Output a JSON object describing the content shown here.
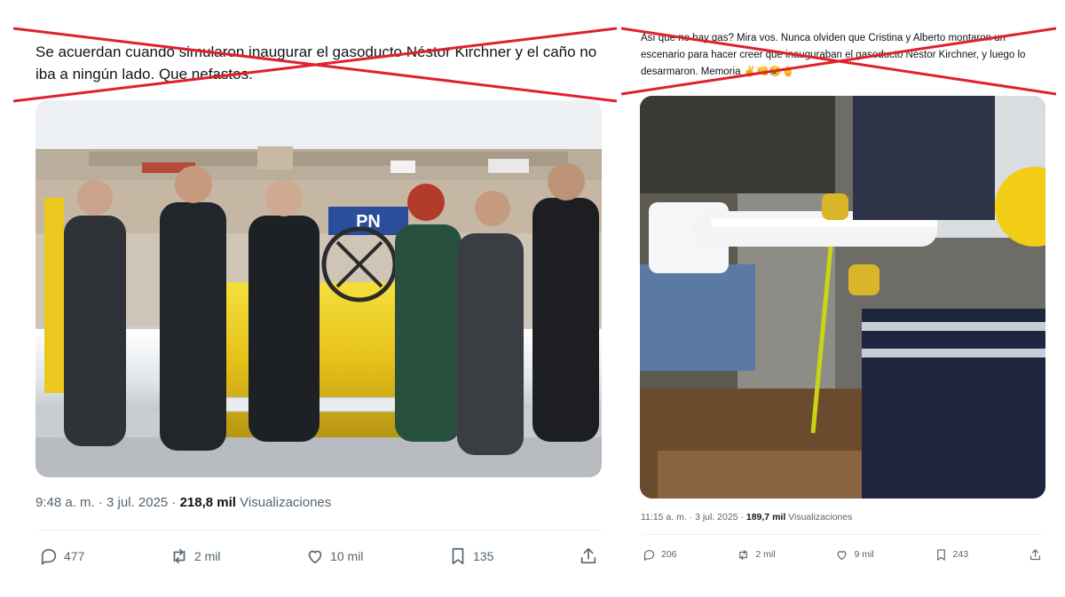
{
  "accent_cross_color": "#e0202b",
  "left_tweet": {
    "text": "Se acuerdan cuando simularon inaugurar el gasoducto Néstor Kirchner y el caño no iba a ningún lado. Que nefastos.",
    "time_date": "9:48 a. m. · 3 jul. 2025 · ",
    "views_count": "218,8 mil",
    "views_label": " Visualizaciones",
    "media_sign_text": "PN",
    "actions": {
      "reply_count": "477",
      "retweet_count": "2 mil",
      "like_count": "10 mil",
      "bookmark_count": "135"
    },
    "icons": [
      "reply-icon",
      "retweet-icon",
      "like-icon",
      "bookmark-icon",
      "share-icon"
    ]
  },
  "right_tweet": {
    "text": "Así que no hay gas? Mira vos. Nunca olviden que Cristina y Alberto montaron un escenario para hacer creer que inauguraban el gasoducto Néstor Kirchner, y luego lo desarmaron. Memoria ✌️👊😢🖕",
    "time_date": "11:15 a. m. · 3 jul. 2025 · ",
    "views_count": "189,7 mil",
    "views_label": " Visualizaciones",
    "actions": {
      "reply_count": "206",
      "retweet_count": "2 mil",
      "like_count": "9 mil",
      "bookmark_count": "243"
    },
    "icons": [
      "reply-icon",
      "retweet-icon",
      "like-icon",
      "bookmark-icon",
      "share-icon"
    ]
  }
}
